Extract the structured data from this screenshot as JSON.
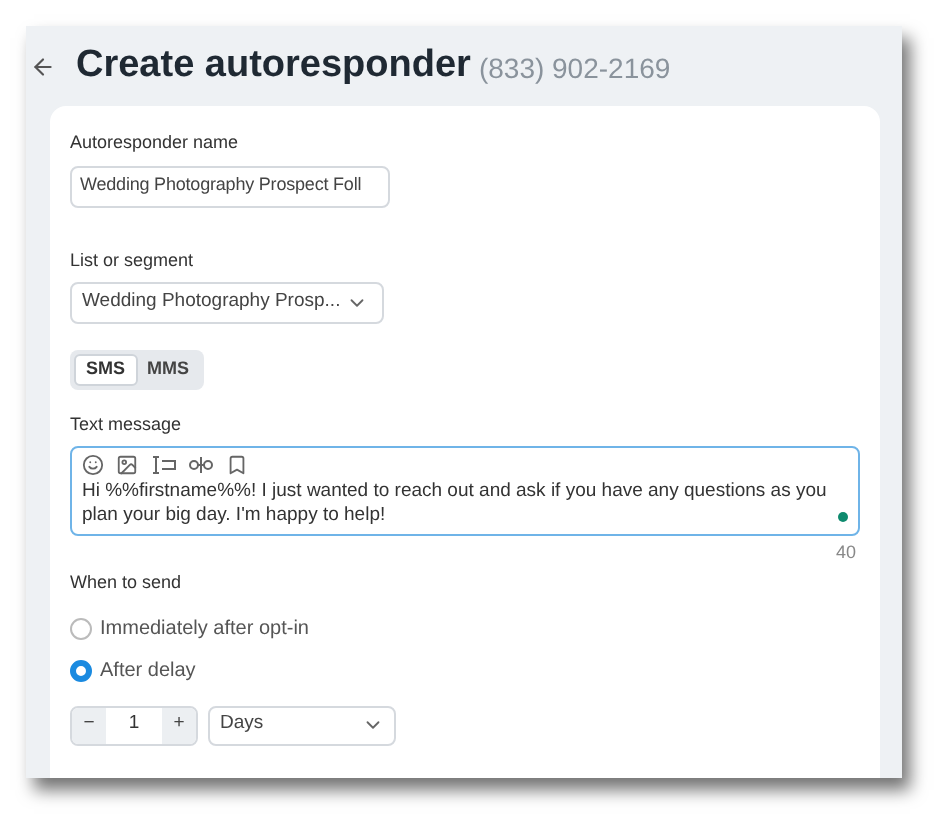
{
  "header": {
    "title": "Create autoresponder",
    "phone": "(833) 902-2169"
  },
  "name_field": {
    "label": "Autoresponder name",
    "value": "Wedding Photography Prospect Foll"
  },
  "list_field": {
    "label": "List or segment",
    "value": "Wedding Photography Prosp..."
  },
  "message_type": [
    {
      "label": "SMS",
      "selected": true
    },
    {
      "label": "MMS",
      "selected": false
    }
  ],
  "text_message": {
    "label": "Text message",
    "value": "Hi %%firstname%%! I just wanted to reach out and ask if you have any questions as you plan your big day. I'm happy to help!",
    "count": "40"
  },
  "when_to_send": {
    "label": "When to send",
    "options": [
      {
        "label": "Immediately after opt-in",
        "selected": false
      },
      {
        "label": "After delay",
        "selected": true
      }
    ]
  },
  "delay": {
    "minus": "−",
    "value": "1",
    "plus": "+",
    "unit": "Days"
  }
}
